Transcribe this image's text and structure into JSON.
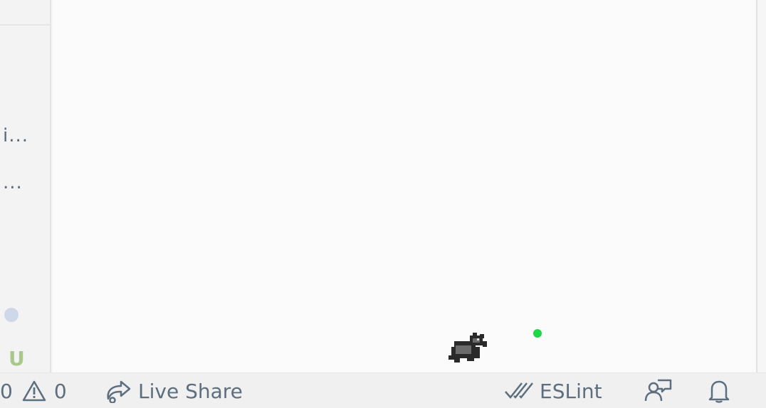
{
  "sidebar": {
    "items": [
      {
        "label": "i..."
      },
      {
        "label": "..."
      }
    ],
    "git_status": "U"
  },
  "statusbar": {
    "errors_count": "0",
    "warnings_count": "0",
    "live_share_label": "Live Share",
    "eslint_label": "ESLint"
  },
  "colors": {
    "ball": "#1fd64a",
    "statusbar_text": "#5d6e7e",
    "git_untracked": "#a9c98c"
  },
  "icons": {
    "warning": "warning-icon",
    "live_share": "live-share-icon",
    "eslint": "double-check-icon",
    "feedback": "feedback-icon",
    "notifications": "bell-icon"
  }
}
